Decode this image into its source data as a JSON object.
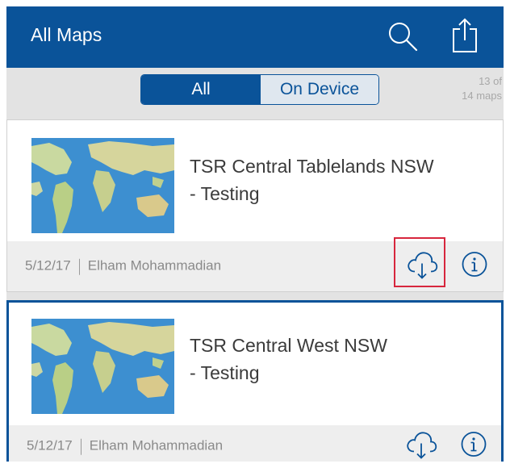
{
  "header": {
    "title": "All Maps",
    "search_icon": "search-icon",
    "share_icon": "share-icon"
  },
  "filter": {
    "all_label": "All",
    "on_device_label": "On Device",
    "selected": "All"
  },
  "count": {
    "line1": "13 of",
    "line2": "14 maps"
  },
  "maps": [
    {
      "title_line1": "TSR Central Tablelands NSW",
      "title_line2": "- Testing",
      "date": "5/12/17",
      "owner": "Elham Mohammadian",
      "download_icon": "cloud-download-icon",
      "info_icon": "info-icon"
    },
    {
      "title_line1": "TSR Central West NSW",
      "title_line2": "- Testing",
      "date": "5/12/17",
      "owner": "Elham Mohammadian",
      "download_icon": "cloud-download-icon",
      "info_icon": "info-icon"
    }
  ],
  "colors": {
    "brand": "#0a5399",
    "background": "#e3e3e3",
    "highlight": "#d7263d"
  }
}
